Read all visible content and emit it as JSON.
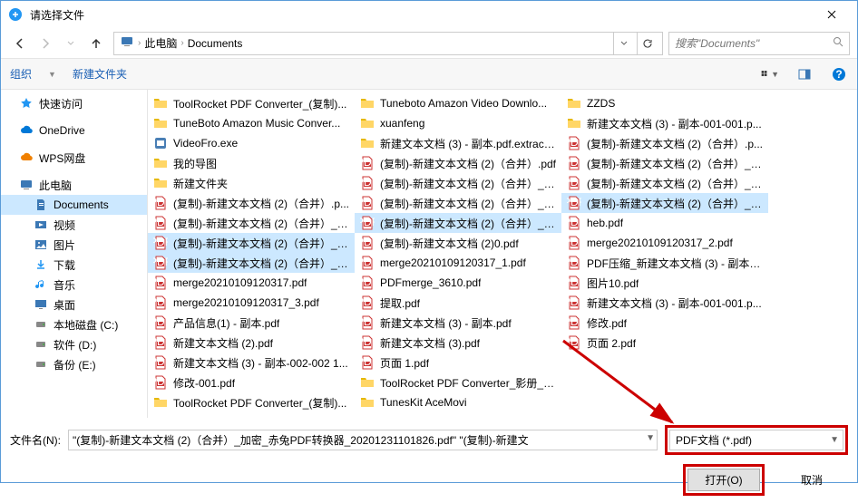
{
  "title": "请选择文件",
  "breadcrumb": {
    "root": "此电脑",
    "folder": "Documents"
  },
  "search_placeholder": "搜索\"Documents\"",
  "toolbar": {
    "organize": "组织",
    "newfolder": "新建文件夹"
  },
  "sidebar": [
    {
      "label": "快速访问",
      "icon": "star",
      "color": "#2196f3"
    },
    {
      "label": "OneDrive",
      "icon": "cloud",
      "color": "#0078d7"
    },
    {
      "label": "WPS网盘",
      "icon": "cloud",
      "color": "#f08000"
    },
    {
      "label": "此电脑",
      "icon": "pc",
      "color": "#3b78b5"
    },
    {
      "label": "Documents",
      "icon": "doc",
      "sub": true,
      "sel": true,
      "color": "#3b78b5"
    },
    {
      "label": "视频",
      "icon": "video",
      "sub": true,
      "color": "#3b78b5"
    },
    {
      "label": "图片",
      "icon": "pic",
      "sub": true,
      "color": "#3b78b5"
    },
    {
      "label": "下载",
      "icon": "down",
      "sub": true,
      "color": "#2196f3"
    },
    {
      "label": "音乐",
      "icon": "music",
      "sub": true,
      "color": "#2196f3"
    },
    {
      "label": "桌面",
      "icon": "desktop",
      "sub": true,
      "color": "#3b78b5"
    },
    {
      "label": "本地磁盘 (C:)",
      "icon": "disk",
      "sub": true,
      "color": "#888"
    },
    {
      "label": "软件 (D:)",
      "icon": "disk",
      "sub": true,
      "color": "#888"
    },
    {
      "label": "备份 (E:)",
      "icon": "disk",
      "sub": true,
      "color": "#888"
    }
  ],
  "files": [
    {
      "name": "ToolRocket PDF Converter_(复制)...",
      "type": "folder"
    },
    {
      "name": "TuneBoto Amazon Music Conver...",
      "type": "folder"
    },
    {
      "name": "VideoFro.exe",
      "type": "exe"
    },
    {
      "name": "我的导图",
      "type": "folder"
    },
    {
      "name": "新建文件夹",
      "type": "folder"
    },
    {
      "name": "(复制)-新建文本文档 (2)（合并）.p...",
      "type": "pdf"
    },
    {
      "name": "(复制)-新建文本文档 (2)（合并）_加...",
      "type": "pdf"
    },
    {
      "name": "(复制)-新建文本文档 (2)（合并）_加...",
      "type": "pdf",
      "sel": true
    },
    {
      "name": "(复制)-新建文本文档 (2)（合并）_已...",
      "type": "pdf",
      "sel": true
    },
    {
      "name": "merge20210109120317.pdf",
      "type": "pdf"
    },
    {
      "name": "merge20210109120317_3.pdf",
      "type": "pdf"
    },
    {
      "name": "产品信息(1) - 副本.pdf",
      "type": "pdf"
    },
    {
      "name": "新建文本文档 (2).pdf",
      "type": "pdf"
    },
    {
      "name": "新建文本文档 (3) - 副本-002-002 1...",
      "type": "pdf"
    },
    {
      "name": "修改-001.pdf",
      "type": "pdf"
    },
    {
      "name": "ToolRocket PDF Converter_(复制)...",
      "type": "folder"
    },
    {
      "name": "Tuneboto Amazon Video Downlo...",
      "type": "folder"
    },
    {
      "name": "xuanfeng",
      "type": "folder"
    },
    {
      "name": "新建文本文档 (3) - 副本.pdf.extract...",
      "type": "folder"
    },
    {
      "name": "(复制)-新建文本文档 (2)（合并）.pdf",
      "type": "pdf"
    },
    {
      "name": "(复制)-新建文本文档 (2)（合并）_1...",
      "type": "pdf"
    },
    {
      "name": "(复制)-新建文本文档 (2)（合并）_加...",
      "type": "pdf"
    },
    {
      "name": "(复制)-新建文本文档 (2)（合并）_加...",
      "type": "pdf",
      "sel": true
    },
    {
      "name": "(复制)-新建文本文档 (2)0.pdf",
      "type": "pdf"
    },
    {
      "name": "merge20210109120317_1.pdf",
      "type": "pdf"
    },
    {
      "name": "PDFmerge_3610.pdf",
      "type": "pdf"
    },
    {
      "name": "提取.pdf",
      "type": "pdf"
    },
    {
      "name": "新建文本文档 (3) - 副本.pdf",
      "type": "pdf"
    },
    {
      "name": "新建文本文档 (3).pdf",
      "type": "pdf"
    },
    {
      "name": "页面 1.pdf",
      "type": "pdf"
    },
    {
      "name": "ToolRocket PDF Converter_影册_s...",
      "type": "folder"
    },
    {
      "name": "TunesKit AceMovi",
      "type": "folder"
    },
    {
      "name": "ZZDS",
      "type": "folder"
    },
    {
      "name": "新建文本文档 (3) - 副本-001-001.p...",
      "type": "folder"
    },
    {
      "name": "(复制)-新建文本文档 (2)（合并）.p...",
      "type": "pdf"
    },
    {
      "name": "(复制)-新建文本文档 (2)（合并）_C...",
      "type": "pdf"
    },
    {
      "name": "(复制)-新建文本文档 (2)（合并）_加...",
      "type": "pdf"
    },
    {
      "name": "(复制)-新建文本文档 (2)（合并）_已...",
      "type": "pdf",
      "sel": true
    },
    {
      "name": "heb.pdf",
      "type": "pdf"
    },
    {
      "name": "merge20210109120317_2.pdf",
      "type": "pdf"
    },
    {
      "name": "PDF压缩_新建文本文档 (3) - 副本_...",
      "type": "pdf"
    },
    {
      "name": "图片10.pdf",
      "type": "pdf"
    },
    {
      "name": "新建文本文档 (3) - 副本-001-001.p...",
      "type": "pdf"
    },
    {
      "name": "修改.pdf",
      "type": "pdf"
    },
    {
      "name": "页面 2.pdf",
      "type": "pdf"
    }
  ],
  "filename_label": "文件名(N):",
  "filename_value": "\"(复制)-新建文本文档 (2)（合并）_加密_赤兔PDF转换器_20201231101826.pdf\" \"(复制)-新建文",
  "filetype": "PDF文档 (*.pdf)",
  "btn_open": "打开(O)",
  "btn_cancel": "取消"
}
